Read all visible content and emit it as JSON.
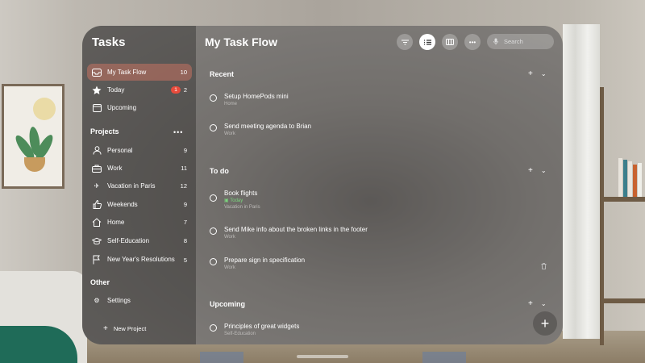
{
  "app": {
    "title": "Tasks"
  },
  "sidebar": {
    "smart_lists": [
      {
        "label": "My Task Flow",
        "count": "10",
        "icon": "tray-icon",
        "active": true
      },
      {
        "label": "Today",
        "count": "2",
        "badge": "1",
        "icon": "star-icon"
      },
      {
        "label": "Upcoming",
        "count": "",
        "icon": "calendar-icon"
      }
    ],
    "projects_header": "Projects",
    "projects": [
      {
        "label": "Personal",
        "count": "9",
        "icon": "person-icon"
      },
      {
        "label": "Work",
        "count": "11",
        "icon": "briefcase-icon"
      },
      {
        "label": "Vacation in Paris",
        "count": "12",
        "icon": "airplane-icon"
      },
      {
        "label": "Weekends",
        "count": "9",
        "icon": "thumbs-up-icon"
      },
      {
        "label": "Home",
        "count": "7",
        "icon": "house-icon"
      },
      {
        "label": "Self-Education",
        "count": "8",
        "icon": "graduation-cap-icon"
      },
      {
        "label": "New Year's Resolutions",
        "count": "5",
        "icon": "flag-icon"
      }
    ],
    "other_header": "Other",
    "settings_label": "Settings",
    "new_project_label": "New Project"
  },
  "main": {
    "title": "My Task Flow",
    "search_placeholder": "Search",
    "groups": [
      {
        "title": "Recent",
        "tasks": [
          {
            "title": "Setup HomePods mini",
            "sub": "Home"
          },
          {
            "title": "Send meeting agenda to Brian",
            "sub": "Work"
          }
        ]
      },
      {
        "title": "To do",
        "tasks": [
          {
            "title": "Book flights",
            "date": "Today",
            "sub": "Vacation in Paris"
          },
          {
            "title": "Send Mike info about the broken links in the footer",
            "sub": "Work"
          },
          {
            "title": "Prepare sign in specification",
            "sub": "Work"
          }
        ]
      },
      {
        "title": "Upcoming",
        "tasks": [
          {
            "title": "Principles of great widgets",
            "sub": "Self-Education"
          }
        ]
      }
    ]
  },
  "colors": {
    "active_item": "#dc7864",
    "badge": "#e84b3c",
    "today": "#7bd57d"
  }
}
